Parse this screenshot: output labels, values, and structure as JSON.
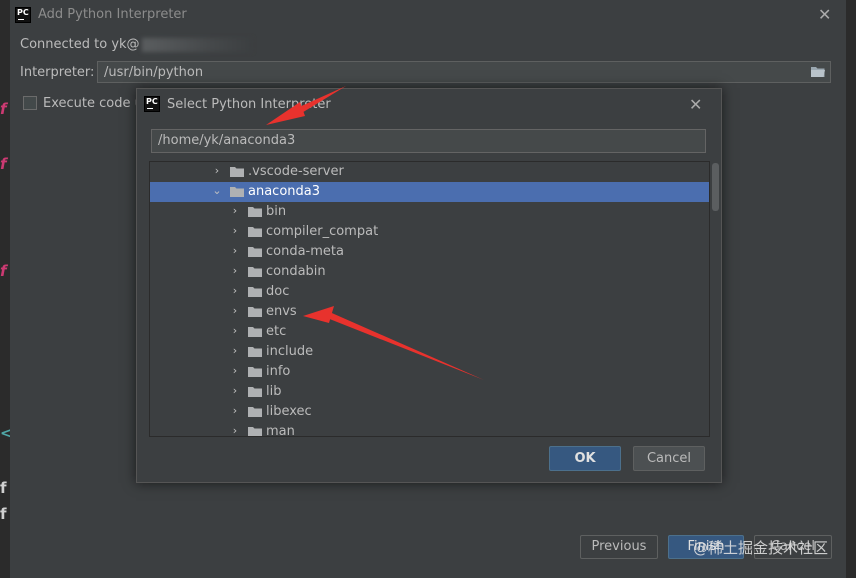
{
  "outer": {
    "title": "Add Python Interpreter",
    "connected_label": "Connected to yk@",
    "interpreter_label": "Interpreter:",
    "interpreter_value": "/usr/bin/python",
    "execute_label": "Execute code us",
    "previous_label": "Previous",
    "finish_label": "Finish",
    "cancel_label": "Cancel",
    "watermark": "@稀土掘金技术社区"
  },
  "inner": {
    "title": "Select Python Interpreter",
    "path_value": "/home/yk/anaconda3",
    "tree": [
      {
        "label": ".vscode-server",
        "level": 0,
        "expanded": false,
        "selected": false
      },
      {
        "label": "anaconda3",
        "level": 0,
        "expanded": true,
        "selected": true
      },
      {
        "label": "bin",
        "level": 1,
        "expanded": false,
        "selected": false
      },
      {
        "label": "compiler_compat",
        "level": 1,
        "expanded": false,
        "selected": false
      },
      {
        "label": "conda-meta",
        "level": 1,
        "expanded": false,
        "selected": false
      },
      {
        "label": "condabin",
        "level": 1,
        "expanded": false,
        "selected": false
      },
      {
        "label": "doc",
        "level": 1,
        "expanded": false,
        "selected": false
      },
      {
        "label": "envs",
        "level": 1,
        "expanded": false,
        "selected": false
      },
      {
        "label": "etc",
        "level": 1,
        "expanded": false,
        "selected": false
      },
      {
        "label": "include",
        "level": 1,
        "expanded": false,
        "selected": false
      },
      {
        "label": "info",
        "level": 1,
        "expanded": false,
        "selected": false
      },
      {
        "label": "lib",
        "level": 1,
        "expanded": false,
        "selected": false
      },
      {
        "label": "libexec",
        "level": 1,
        "expanded": false,
        "selected": false
      },
      {
        "label": "man",
        "level": 1,
        "expanded": false,
        "selected": false
      }
    ],
    "ok_label": "OK",
    "cancel_label": "Cancel"
  },
  "logo_text": "PC",
  "colors": {
    "background": "#3c3f41",
    "selection": "#4b6eaf",
    "primary_button": "#365880",
    "annotation_arrow": "#e8322d"
  },
  "icons": {
    "close": "close-icon",
    "folder": "folder-icon",
    "browse": "folder-browse-icon",
    "chevron_right": "chevron-right-icon",
    "chevron_down": "chevron-down-icon"
  }
}
